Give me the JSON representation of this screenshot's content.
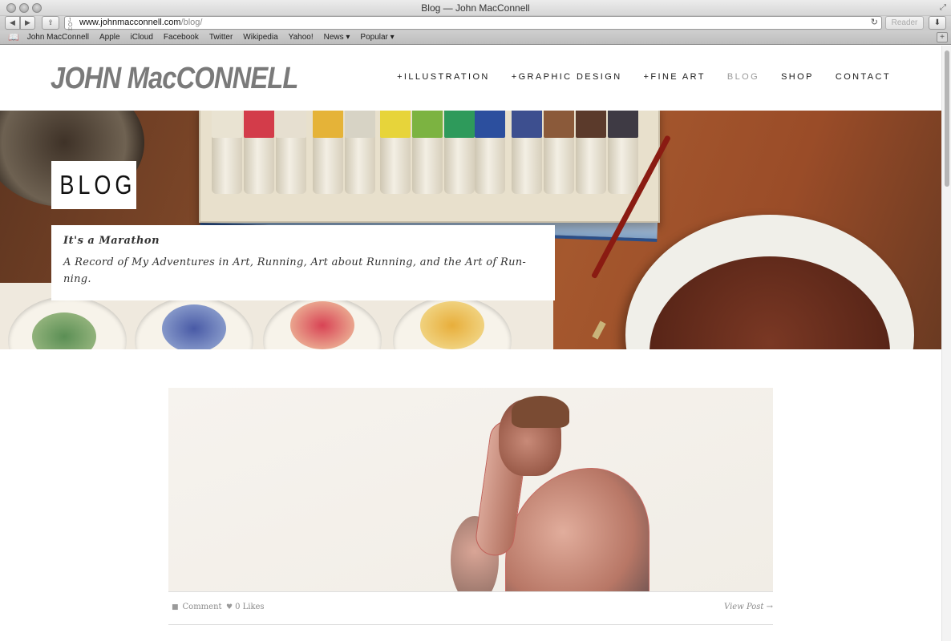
{
  "window": {
    "title": "Blog — John MacConnell"
  },
  "toolbar": {
    "url_host": "www.johnmacconnell.com",
    "url_path": "/blog/",
    "reader_label": "Reader"
  },
  "bookmarks": [
    "John MacConnell",
    "Apple",
    "iCloud",
    "Facebook",
    "Twitter",
    "Wikipedia",
    "Yahoo!",
    "News ▾",
    "Popular ▾"
  ],
  "site": {
    "logo": "JOHN MacCONNELL",
    "nav": [
      {
        "label": "+ILLUSTRATION",
        "active": false
      },
      {
        "label": "+GRAPHIC DESIGN",
        "active": false
      },
      {
        "label": "+FINE ART",
        "active": false
      },
      {
        "label": "BLOG",
        "active": true
      },
      {
        "label": "SHOP",
        "active": false
      },
      {
        "label": "CONTACT",
        "active": false
      }
    ]
  },
  "hero": {
    "badge": "BLOG",
    "title": "It's a Marathon",
    "description": "A Record of My Adventures in Art, Running, Art about Running, and the Art of Run-ning."
  },
  "post": {
    "comment_label": "Comment",
    "likes_label": "0 Likes",
    "view_label": "View Post →"
  },
  "colors": {
    "nav_active": "#9a9a9a",
    "logo": "#7a7a7a"
  }
}
